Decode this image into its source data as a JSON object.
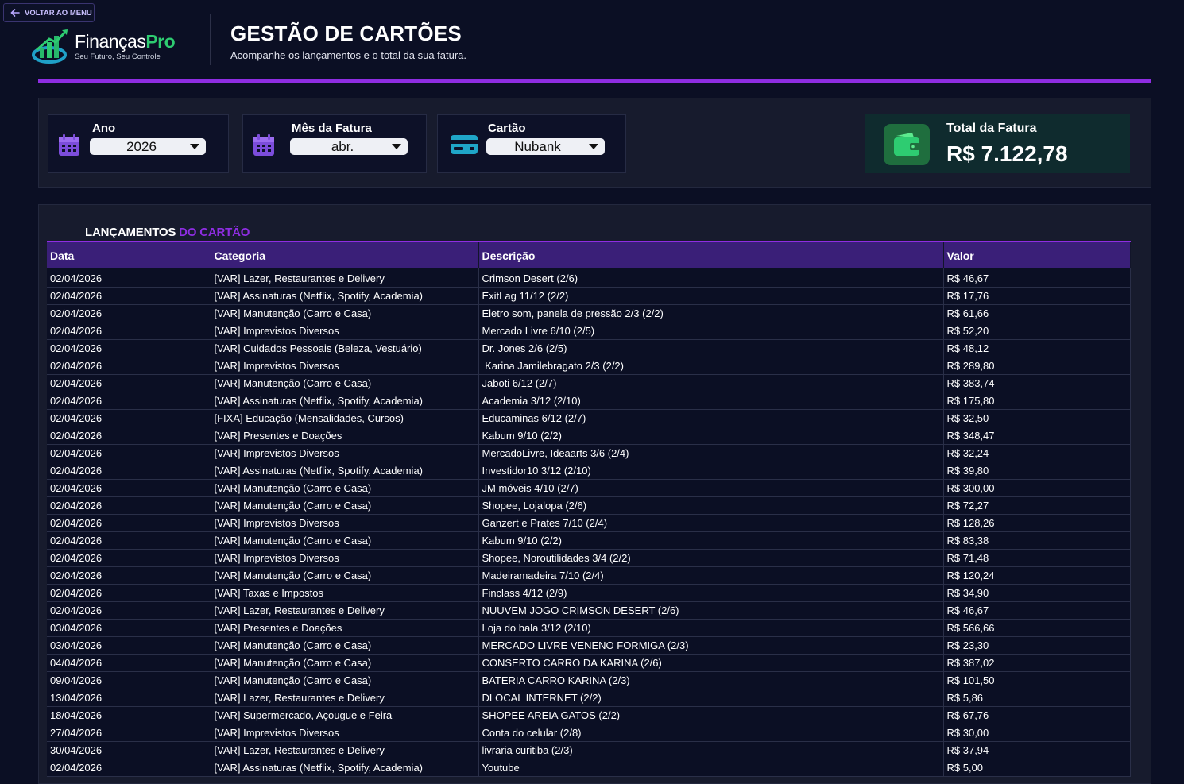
{
  "back_button": {
    "label": "VOLTAR AO MENU"
  },
  "logo": {
    "name_part1": "Finanças",
    "name_part2": "Pro",
    "tagline": "Seu Futuro, Seu Controle"
  },
  "header": {
    "title": "GESTÃO DE CARTÕES",
    "subtitle": "Acompanhe os lançamentos e o total da sua fatura."
  },
  "filters": {
    "year": {
      "label": "Ano",
      "value": "2026"
    },
    "month": {
      "label": "Mês da Fatura",
      "value": "abr."
    },
    "card": {
      "label": "Cartão",
      "value": "Nubank"
    }
  },
  "total": {
    "label": "Total da Fatura",
    "value": "R$ 7.122,78"
  },
  "section": {
    "title_part1": "LANÇAMENTOS",
    "title_part2": " DO CARTÃO"
  },
  "table": {
    "headers": [
      "Data",
      "Categoria",
      "Descrição",
      "Valor"
    ],
    "rows": [
      [
        "02/04/2026",
        "[VAR] Lazer, Restaurantes e Delivery",
        "Crimson Desert (2/6)",
        "R$ 46,67"
      ],
      [
        "02/04/2026",
        "[VAR] Assinaturas (Netflix, Spotify, Academia)",
        "ExitLag 11/12 (2/2)",
        "R$ 17,76"
      ],
      [
        "02/04/2026",
        "[VAR] Manutenção (Carro e Casa)",
        "Eletro som, panela de pressão 2/3 (2/2)",
        "R$ 61,66"
      ],
      [
        "02/04/2026",
        "[VAR] Imprevistos Diversos",
        "Mercado Livre 6/10 (2/5)",
        "R$ 52,20"
      ],
      [
        "02/04/2026",
        "[VAR] Cuidados Pessoais (Beleza, Vestuário)",
        "Dr. Jones 2/6 (2/5)",
        "R$ 48,12"
      ],
      [
        "02/04/2026",
        "[VAR] Imprevistos Diversos",
        " Karina Jamilebragato 2/3 (2/2)",
        "R$ 289,80"
      ],
      [
        "02/04/2026",
        "[VAR] Manutenção (Carro e Casa)",
        "Jaboti 6/12 (2/7)",
        "R$ 383,74"
      ],
      [
        "02/04/2026",
        "[VAR] Assinaturas (Netflix, Spotify, Academia)",
        "Academia 3/12 (2/10)",
        "R$ 175,80"
      ],
      [
        "02/04/2026",
        "[FIXA] Educação (Mensalidades, Cursos)",
        "Educaminas 6/12 (2/7)",
        "R$ 32,50"
      ],
      [
        "02/04/2026",
        "[VAR] Presentes e Doações",
        "Kabum 9/10 (2/2)",
        "R$ 348,47"
      ],
      [
        "02/04/2026",
        "[VAR] Imprevistos Diversos",
        "MercadoLivre, Ideaarts 3/6 (2/4)",
        "R$ 32,24"
      ],
      [
        "02/04/2026",
        "[VAR] Assinaturas (Netflix, Spotify, Academia)",
        "Investidor10 3/12 (2/10)",
        "R$ 39,80"
      ],
      [
        "02/04/2026",
        "[VAR] Manutenção (Carro e Casa)",
        "JM móveis 4/10 (2/7)",
        "R$ 300,00"
      ],
      [
        "02/04/2026",
        "[VAR] Manutenção (Carro e Casa)",
        "Shopee, Lojalopa (2/6)",
        "R$ 72,27"
      ],
      [
        "02/04/2026",
        "[VAR] Imprevistos Diversos",
        "Ganzert e Prates 7/10 (2/4)",
        "R$ 128,26"
      ],
      [
        "02/04/2026",
        "[VAR] Manutenção (Carro e Casa)",
        "Kabum 9/10 (2/2)",
        "R$ 83,38"
      ],
      [
        "02/04/2026",
        "[VAR] Imprevistos Diversos",
        "Shopee, Noroutilidades 3/4 (2/2)",
        "R$ 71,48"
      ],
      [
        "02/04/2026",
        "[VAR] Manutenção (Carro e Casa)",
        "Madeiramadeira 7/10 (2/4)",
        "R$ 120,24"
      ],
      [
        "02/04/2026",
        "[VAR] Taxas e Impostos",
        "Finclass 4/12 (2/9)",
        "R$ 34,90"
      ],
      [
        "02/04/2026",
        "[VAR] Lazer, Restaurantes e Delivery",
        "NUUVEM JOGO CRIMSON DESERT (2/6)",
        "R$ 46,67"
      ],
      [
        "03/04/2026",
        "[VAR] Presentes e Doações",
        "Loja do bala 3/12 (2/10)",
        "R$ 566,66"
      ],
      [
        "03/04/2026",
        "[VAR] Manutenção (Carro e Casa)",
        "MERCADO LIVRE VENENO FORMIGA (2/3)",
        "R$ 23,30"
      ],
      [
        "04/04/2026",
        "[VAR] Manutenção (Carro e Casa)",
        "CONSERTO CARRO DA KARINA (2/6)",
        "R$ 387,02"
      ],
      [
        "09/04/2026",
        "[VAR] Manutenção (Carro e Casa)",
        "BATERIA CARRO KARINA (2/3)",
        "R$ 101,50"
      ],
      [
        "13/04/2026",
        "[VAR] Lazer, Restaurantes e Delivery",
        "DLOCAL INTERNET (2/2)",
        "R$ 5,86"
      ],
      [
        "18/04/2026",
        "[VAR] Supermercado, Açougue e Feira",
        "SHOPEE AREIA GATOS (2/2)",
        "R$ 67,76"
      ],
      [
        "27/04/2026",
        "[VAR] Imprevistos Diversos",
        "Conta do celular (2/8)",
        "R$ 30,00"
      ],
      [
        "30/04/2026",
        "[VAR] Lazer, Restaurantes e Delivery",
        "livraria curitiba (2/3)",
        "R$ 37,94"
      ],
      [
        "02/04/2026",
        "[VAR] Assinaturas (Netflix, Spotify, Academia)",
        "Youtube",
        "R$ 5,00"
      ]
    ]
  },
  "colors": {
    "accent": "#8e2de2",
    "background": "#0b0f24",
    "panel": "#171b2d",
    "total_card": "#0f2b2e",
    "wallet": "#2ecc71"
  },
  "icons": {
    "back": "arrow-left-icon",
    "year": "calendar-icon",
    "month": "calendar-icon",
    "card": "credit-card-icon",
    "total": "wallet-icon"
  }
}
